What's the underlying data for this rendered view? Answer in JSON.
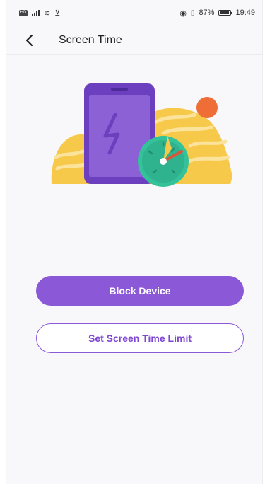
{
  "status_bar": {
    "sim_label": "HD",
    "battery_text": "87%",
    "battery_level": 0.87,
    "time": "19:49"
  },
  "header": {
    "title": "Screen Time"
  },
  "actions": {
    "block_device_label": "Block Device",
    "set_limit_label": "Set Screen Time Limit"
  },
  "colors": {
    "accent": "#8b58d8",
    "phone": "#7b4cc9",
    "phone_screen": "#8d61d6",
    "sand": "#f7c94b",
    "clock": "#33c29a",
    "sun": "#ef6e37"
  },
  "icons": {
    "back": "chevron-left-icon",
    "illustration": "phone-clock-illustration"
  }
}
